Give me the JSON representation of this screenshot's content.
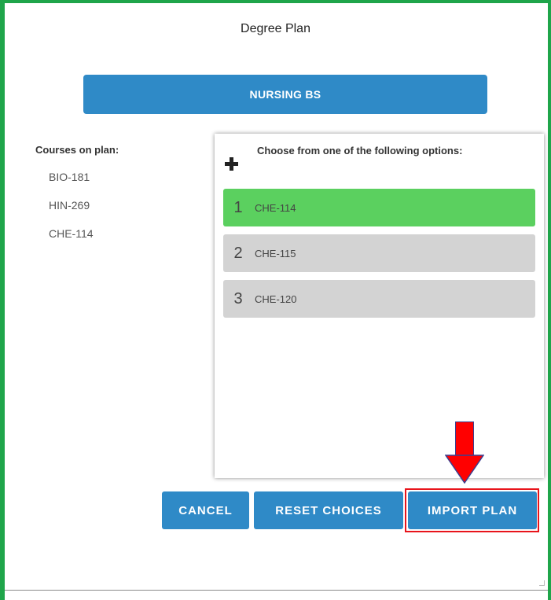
{
  "dialog": {
    "title": "Degree Plan",
    "program_label": "NURSING BS"
  },
  "courses_on_plan": {
    "heading": "Courses on plan:",
    "items": [
      "BIO-181",
      "HIN-269",
      "CHE-114"
    ]
  },
  "options_panel": {
    "heading": "Choose from one of the following options:",
    "add_icon": "plus-icon",
    "options": [
      {
        "number": "1",
        "label": "CHE-114",
        "selected": true
      },
      {
        "number": "2",
        "label": "CHE-115",
        "selected": false
      },
      {
        "number": "3",
        "label": "CHE-120",
        "selected": false
      }
    ]
  },
  "buttons": {
    "cancel": "CANCEL",
    "reset": "RESET CHOICES",
    "import": "IMPORT PLAN"
  },
  "annotation": {
    "arrow_icon": "down-arrow-icon",
    "highlight_color": "#e8141b"
  },
  "colors": {
    "frame": "#1fa54a",
    "primary": "#2f8ac7",
    "selected_option": "#5bd05f",
    "unselected_option": "#d3d3d3"
  }
}
